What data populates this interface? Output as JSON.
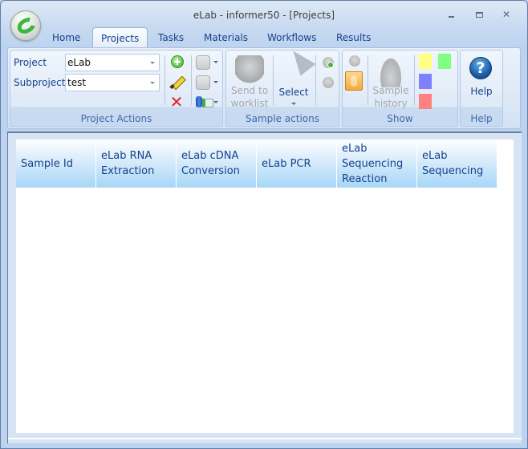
{
  "window": {
    "title": "eLab - informer50 - [Projects]",
    "controls": {
      "minimize": "minimize",
      "maximize": "maximize",
      "close": "✕"
    }
  },
  "tabs": [
    {
      "label": "Home",
      "active": false
    },
    {
      "label": "Projects",
      "active": true
    },
    {
      "label": "Tasks",
      "active": false
    },
    {
      "label": "Materials",
      "active": false
    },
    {
      "label": "Workflows",
      "active": false
    },
    {
      "label": "Results",
      "active": false
    }
  ],
  "ribbon": {
    "project_actions": {
      "label": "Project Actions",
      "project_label": "Project",
      "project_value": "eLab",
      "subproject_label": "Subproject",
      "subproject_value": "test",
      "icons": [
        "add-icon",
        "edit-pencil-icon",
        "delete-icon",
        "document-icon",
        "document-icon",
        "database-export-icon"
      ]
    },
    "sample_actions": {
      "label": "Sample actions",
      "send_to_worklist": "Send to\nworklist",
      "send_line1": "Send to",
      "send_line2": "worklist",
      "select": "Select"
    },
    "show": {
      "label": "Show",
      "sample_history_line1": "Sample",
      "sample_history_line2": "history",
      "colors": {
        "yellow": "#ffff80",
        "green": "#80ff80",
        "blue": "#8080ff",
        "red": "#ff8080"
      }
    },
    "help": {
      "label": "Help",
      "button": "Help",
      "glyph": "?"
    }
  },
  "grid": {
    "columns": [
      "Sample Id",
      "eLab RNA\nExtraction",
      "eLab cDNA\nConversion",
      "eLab PCR",
      "eLab\nSequencing\nReaction",
      "eLab\nSequencing"
    ],
    "rows": []
  }
}
